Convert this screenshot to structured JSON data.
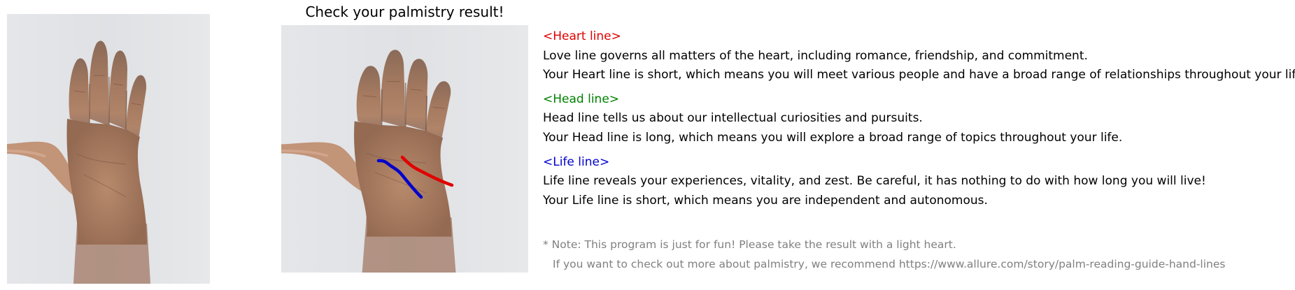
{
  "title": "Check your palmistry result!",
  "images": {
    "original": "hand-photo",
    "annotated": "hand-photo-with-lines"
  },
  "colors": {
    "heart": "#e00000",
    "head": "#008000",
    "life": "#0000cc",
    "note": "#808080",
    "background": "#ffffff"
  },
  "sections": {
    "heart": {
      "label": "<Heart line>",
      "description": "Love line governs all matters of the heart, including romance, friendship, and commitment.",
      "result": "Your Heart line is short, which means you will meet various people and have a broad range of relationships throughout your life."
    },
    "head": {
      "label": "<Head line>",
      "description": "Head line tells us about our intellectual curiosities and pursuits.",
      "result": "Your Head line is long, which means you will explore a broad range of topics throughout your life."
    },
    "life": {
      "label": "<Life line>",
      "description": "Life line reveals your experiences, vitality, and zest. Be careful, it has nothing to do with how long you will live!",
      "result": "Your Life line is short, which means you are independent and autonomous."
    }
  },
  "note": {
    "line1": "* Note: This program is just for fun! Please take the result with a light heart.",
    "line2": "If you want to check out more about palmistry, we recommend https://www.allure.com/story/palm-reading-guide-hand-lines"
  }
}
